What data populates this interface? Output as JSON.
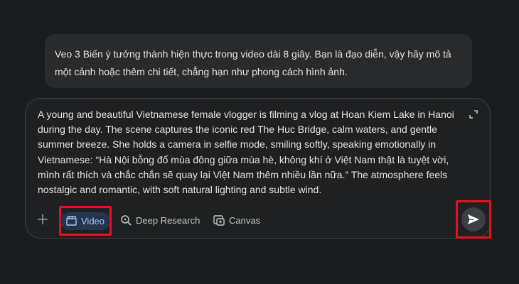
{
  "info_bubble": {
    "text": "Veo 3  Biến ý tưởng thành hiện thực trong video dài 8 giây. Bạn là đạo diễn, vậy hãy mô tả một cảnh hoặc thêm chi tiết, chẳng hạn như phong cách hình ảnh."
  },
  "composer": {
    "prompt": "A young and beautiful Vietnamese female vlogger is filming a vlog at Hoan Kiem Lake in Hanoi during the day. The scene captures the iconic red The Huc Bridge, calm waters, and gentle summer breeze. She holds a camera in selfie mode, smiling softly, speaking emotionally in Vietnamese: “Hà Nội bỗng đổ mùa đông giữa mùa hè, không khí ở Việt Nam thật là tuyệt vời, mình rất thích và chắc chắn sẽ quay lại Việt Nam thêm nhiều lần nữa.” The atmosphere feels nostalgic and romantic, with soft natural lighting and subtle wind."
  },
  "toolbar": {
    "video_label": "Video",
    "research_label": "Deep Research",
    "canvas_label": "Canvas"
  },
  "icons": {
    "plus": "plus-icon",
    "video": "clapperboard-icon",
    "research": "search-sparkle-icon",
    "canvas": "canvas-icon",
    "expand": "expand-icon",
    "send": "send-icon"
  },
  "colors": {
    "background": "#1b1c1d",
    "bubble": "#282a2c",
    "active_chip_bg": "#27344d",
    "active_chip_text": "#a8c7fa",
    "highlight": "#e8101f"
  }
}
